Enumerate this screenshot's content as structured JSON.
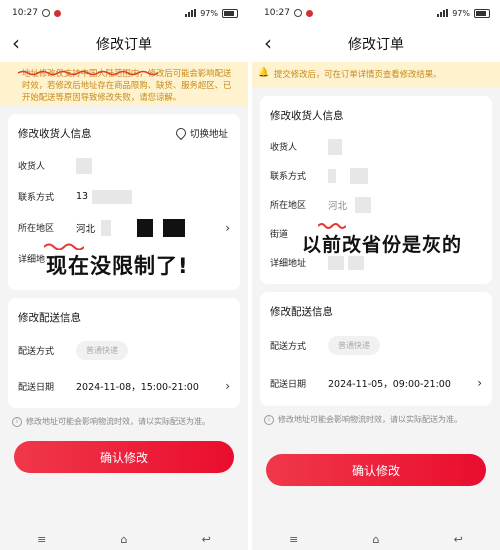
{
  "left": {
    "status": {
      "time": "10:27",
      "battery": "97%"
    },
    "title": "修改订单",
    "notice": "地址修改仅支持中国大陆范围内，修改后可能会影响配送时效，若修改后地址存在商品限购、缺货、服务超区、已开始配送等原因导致修改失败，请您谅解。",
    "address_card": {
      "header": "修改收货人信息",
      "switch_label": "切换地址",
      "rows": {
        "receiver": "收货人",
        "contact": "联系方式",
        "contact_value": "13",
        "region": "所在地区",
        "region_value": "河北",
        "detail": "详细地址"
      }
    },
    "overlay": "现在没限制了!",
    "delivery_card": {
      "header": "修改配送信息",
      "method_label": "配送方式",
      "method_value": "普通快递",
      "date_label": "配送日期",
      "date_value": "2024-11-08，15:00-21:00"
    },
    "hint": "修改地址可能会影响物流时效，请以实际配送为准。",
    "confirm": "确认修改"
  },
  "right": {
    "status": {
      "time": "10:27",
      "battery": "97%"
    },
    "title": "修改订单",
    "notice": "提交修改后，可在订单详情页查看修改结果。",
    "address_card": {
      "header": "修改收货人信息",
      "rows": {
        "receiver": "收货人",
        "contact": "联系方式",
        "region": "所在地区",
        "region_value": "河北",
        "street": "街道",
        "detail": "详细地址"
      }
    },
    "overlay": "以前改省份是灰的",
    "delivery_card": {
      "header": "修改配送信息",
      "method_label": "配送方式",
      "method_value": "普通快递",
      "date_label": "配送日期",
      "date_value": "2024-11-05，09:00-21:00"
    },
    "hint": "修改地址可能会影响物流时效，请以实际配送为准。",
    "confirm": "确认修改"
  },
  "colors": {
    "accent": "#ea0c2e",
    "notice_bg": "#fff3cf",
    "notice_text": "#c58a1a"
  }
}
